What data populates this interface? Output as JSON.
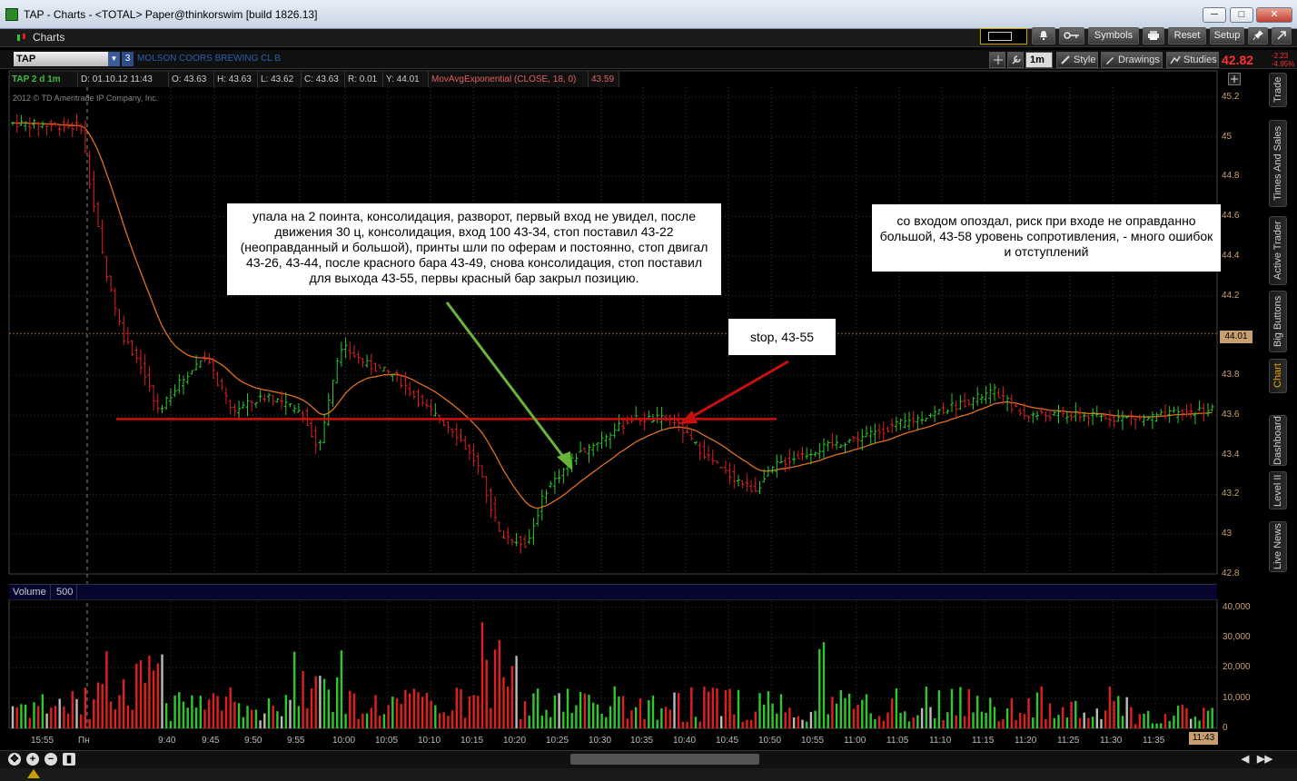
{
  "window": {
    "title": "TAP - Charts - <TOTAL> Paper@thinkorswim [build 1826.13]",
    "btn_minimize": "─",
    "btn_maximize": "□",
    "btn_close": "✕"
  },
  "toolbar": {
    "charts_tab": "Charts",
    "symbols": "Symbols",
    "reset": "Reset",
    "setup": "Setup"
  },
  "symbol": {
    "ticker": "TAP",
    "badge": "3",
    "name": "MOLSON COORS BREWING CL B",
    "timeframe": "1m",
    "style": "Style",
    "drawings": "Drawings",
    "studies": "Studies",
    "last": "42.82",
    "net_change": "-2.23",
    "pct_change": "-4.95%"
  },
  "info": {
    "chart_id": "TAP 2 d 1m",
    "date": "D: 01.10.12 11:43",
    "open": "O: 43.63",
    "high": "H: 43.63",
    "low": "L: 43.62",
    "close": "C: 43.63",
    "range": "R: 0.01",
    "y": "Y: 44.01",
    "study": "MovAvgExponential (CLOSE, 18, 0)",
    "study_value": "43.59",
    "copyright": "2012 © TD Ameritrade IP Company, Inc."
  },
  "annotations": {
    "main_note": "упала на 2 поинта, консолидация, разворот, первый вход не увидел, после движения 30 ц, консолидация, вход 100 43-34, стоп поставил 43-22 (неоправданный и большой), принты шли по оферам и постоянно, стоп двигал 43-26, 43-44, после красного бара 43-49, снова консолидация, стоп поставил для выхода 43-55, первы красный бар закрыл позицию.",
    "stop_note": "stop, 43-55",
    "right_note": "со входом опоздал, риск при входе не оправданно большой, 43-58 уровень сопротивления, - много ошибок и отступлений"
  },
  "price_axis": {
    "labels": [
      "45.2",
      "45",
      "44.8",
      "44.6",
      "44.4",
      "44.2",
      "44",
      "43.8",
      "43.6",
      "43.4",
      "43.2",
      "43",
      "42.8"
    ],
    "current": "44.01"
  },
  "volume": {
    "label": "Volume",
    "value": "500",
    "axis_labels": [
      "40,000",
      "30,000",
      "20,000",
      "10,000",
      "0"
    ]
  },
  "time_axis": {
    "labels": [
      "15:55",
      "Пн",
      "9:40",
      "9:45",
      "9:50",
      "9:55",
      "10:00",
      "10:05",
      "10:10",
      "10:15",
      "10:20",
      "10:25",
      "10:30",
      "10:35",
      "10:40",
      "10:45",
      "10:50",
      "10:55",
      "11:00",
      "11:05",
      "11:10",
      "11:15",
      "11:20",
      "11:25",
      "11:30",
      "11:35"
    ],
    "current": "11:43"
  },
  "side_tabs": [
    "Trade",
    "Times And Sales",
    "Active Trader",
    "Big Buttons",
    "Chart",
    "Dashboard",
    "Level II",
    "Live News"
  ],
  "colors": {
    "up": "#2ec82e",
    "down": "#e02020",
    "ema": "#e07020",
    "resistance": "#d01010",
    "arrow_green": "#6ab43a",
    "arrow_red": "#c81010",
    "axis": "#c8a070"
  },
  "chart_data": {
    "type": "candlestick",
    "symbol": "TAP",
    "interval": "1m",
    "ylim": [
      42.8,
      45.25
    ],
    "volume_ylim": [
      0,
      42000
    ],
    "ema_label": "MovAvgExponential (CLOSE, 18, 0)",
    "ema_last": 43.59,
    "resistance_level": 43.58,
    "last_price": 43.63,
    "high_of_session": 45.1,
    "low_of_session": 42.92,
    "entry_price": 43.34,
    "exit_stop_price": 43.55
  }
}
